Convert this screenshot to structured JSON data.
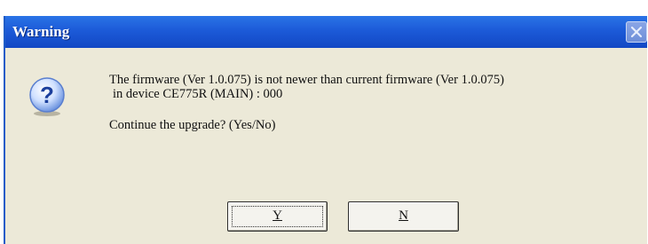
{
  "dialog": {
    "title": "Warning",
    "message_line1": "The firmware (Ver 1.0.075) is not newer than current firmware (Ver 1.0.075)",
    "message_line2": "in device CE775R (MAIN) : 000",
    "prompt": "Continue the upgrade? (Yes/No)",
    "yes_label": "Y",
    "no_label": "N",
    "icon": "question-icon",
    "close_icon": "close-icon"
  }
}
